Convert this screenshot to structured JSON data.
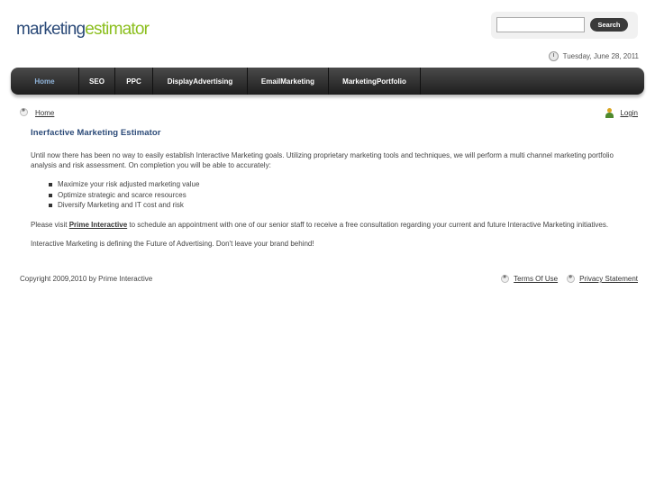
{
  "logo": {
    "part1": "marketing",
    "part2": "estimator"
  },
  "search": {
    "placeholder": "",
    "button_label": "Search"
  },
  "header": {
    "date": "Tuesday, June 28, 2011"
  },
  "nav": {
    "items": [
      {
        "label": "Home"
      },
      {
        "label": "SEO"
      },
      {
        "label": "PPC"
      },
      {
        "label": "DisplayAdvertising"
      },
      {
        "label": "EmailMarketing"
      },
      {
        "label": "MarketingPortfolio"
      }
    ]
  },
  "breadcrumb": {
    "home": "Home",
    "login": "Login"
  },
  "content": {
    "title": "Inerfactive Marketing Estimator",
    "intro": "Until now there has been no way to easily establish Interactive Marketing goals. Utilizing proprietary marketing tools and techniques, we will perform a multi channel marketing portfolio analysis and risk assessment. On completion you will be able to accurately:",
    "bullets": [
      "Maximize your risk adjusted marketing value",
      "Optimize strategic and scarce resources",
      "Diversify Marketing and IT cost and risk"
    ],
    "visit_prefix": "Please visit ",
    "visit_link": "Prime Interactive",
    "visit_suffix": " to schedule an appointment with one of our senior staff to receive a free consultation regarding your current and future Interactive Marketing initiatives.",
    "closing": "Interactive Marketing is defining the Future of Advertising. Don't leave your brand behind!"
  },
  "footer": {
    "copyright": "Copyright 2009,2010 by Prime Interactive",
    "terms": "Terms Of Use",
    "privacy": "Privacy Statement"
  }
}
